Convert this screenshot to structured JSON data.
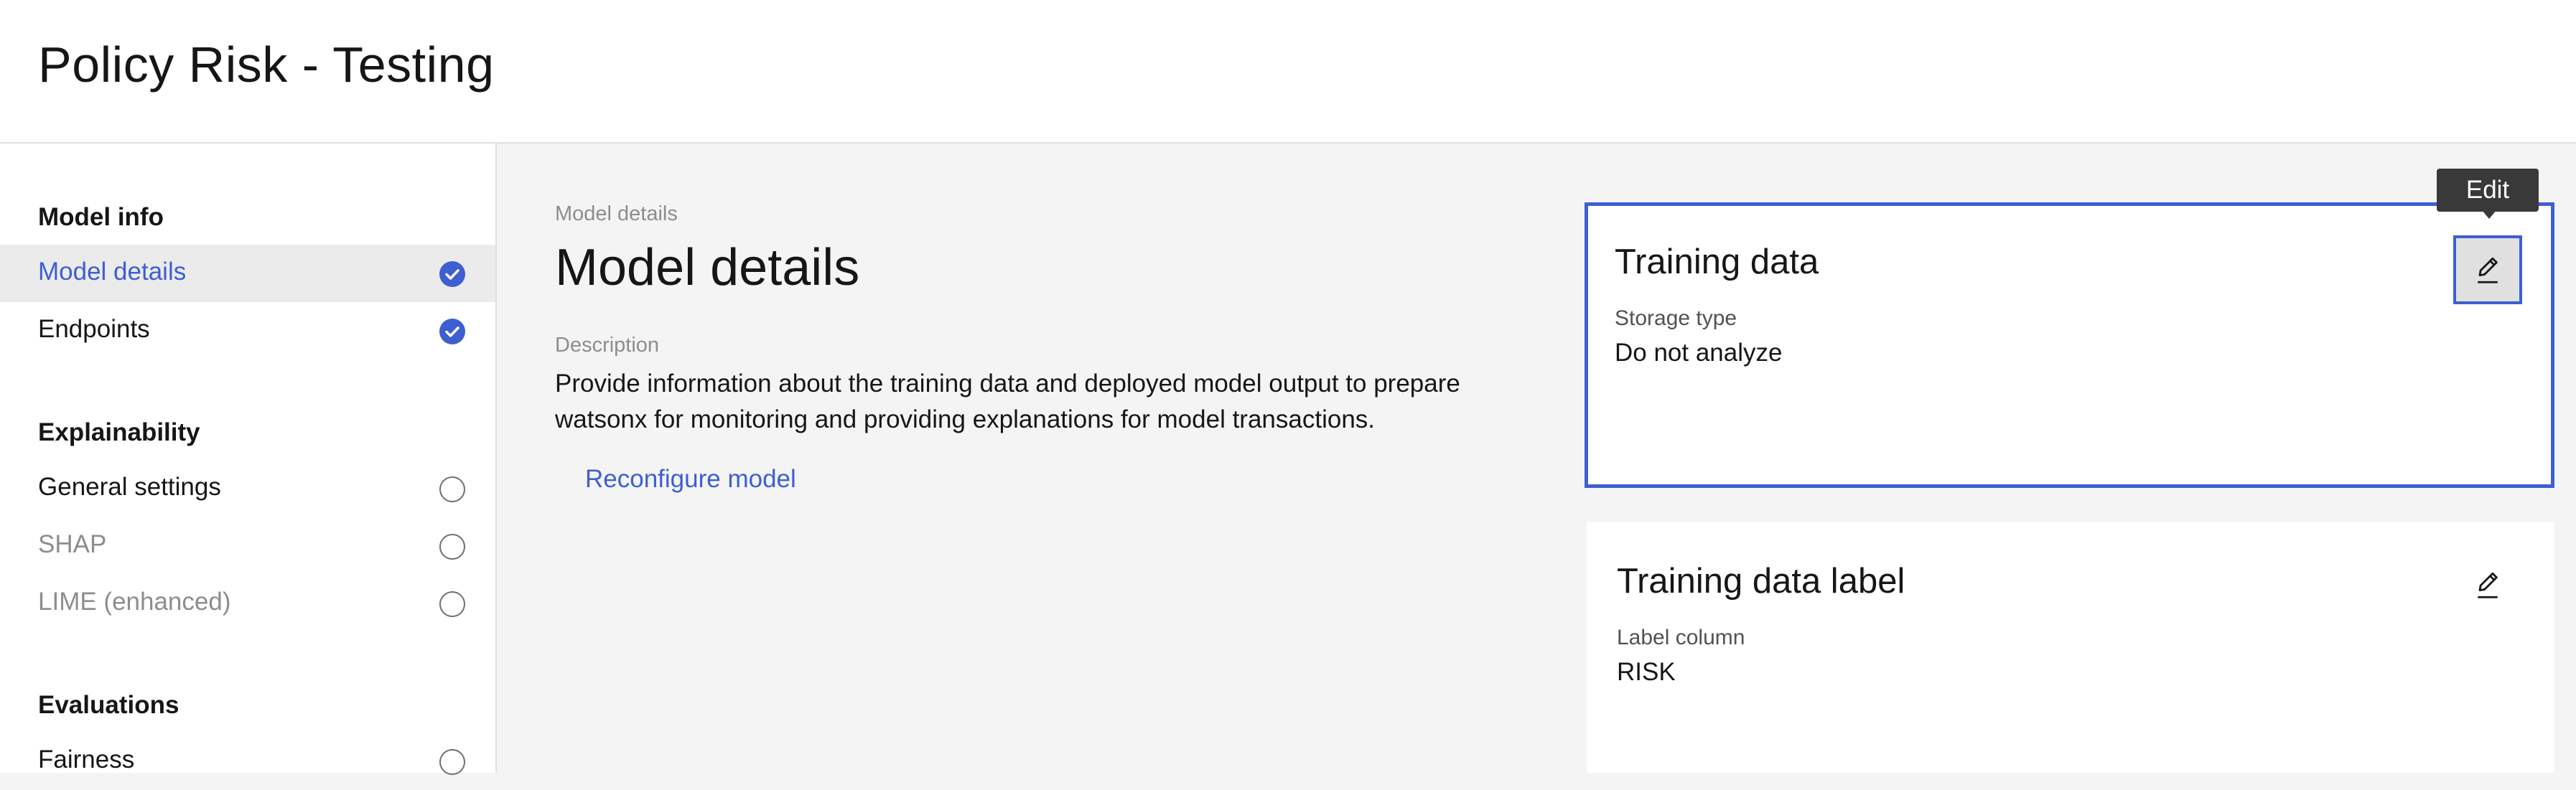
{
  "header": {
    "title": "Policy Risk - Testing"
  },
  "sidebar": {
    "sections": [
      {
        "heading": "Model info",
        "items": [
          {
            "label": "Model details",
            "status": "complete",
            "active": true
          },
          {
            "label": "Endpoints",
            "status": "complete"
          }
        ]
      },
      {
        "heading": "Explainability",
        "items": [
          {
            "label": "General settings",
            "status": "incomplete"
          },
          {
            "label": "SHAP",
            "status": "incomplete",
            "disabled": true
          },
          {
            "label": "LIME (enhanced)",
            "status": "incomplete",
            "disabled": true
          }
        ]
      },
      {
        "heading": "Evaluations",
        "items": [
          {
            "label": "Fairness",
            "status": "incomplete"
          }
        ]
      }
    ]
  },
  "main": {
    "breadcrumb": "Model details",
    "title": "Model details",
    "description_label": "Description",
    "description": "Provide information about the training data and deployed model output to prepare watsonx for monitoring and providing explanations for model transactions.",
    "reconfigure_link": "Reconfigure model"
  },
  "tiles": [
    {
      "title": "Training data",
      "field_label": "Storage type",
      "field_value": "Do not analyze",
      "icon": "edit-icon"
    },
    {
      "title": "Training data label",
      "field_label": "Label column",
      "field_value": "RISK",
      "icon": "edit-icon"
    }
  ],
  "tooltip": {
    "text": "Edit"
  },
  "colors": {
    "accent": "#3d5fd1",
    "tooltip_bg": "#393939",
    "page_bg": "#f4f4f4"
  }
}
